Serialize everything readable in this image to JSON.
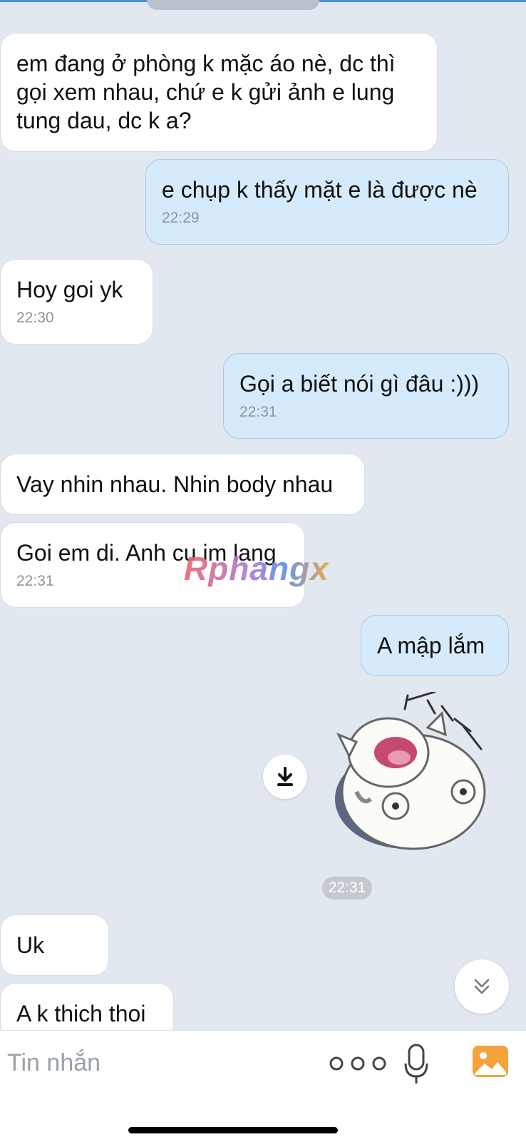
{
  "messages": [
    {
      "dir": "in",
      "text": "em đang ở phòng k mặc áo nè, dc thì\ngọi xem nhau, chứ e k gửi ảnh e lung\ntung dau, dc k a?",
      "time": ""
    },
    {
      "dir": "out",
      "text": "e chụp k thấy mặt e là được nè",
      "time": "22:29"
    },
    {
      "dir": "in",
      "text": "Hoy goi yk",
      "time": "22:30"
    },
    {
      "dir": "out",
      "text": "Gọi a biết nói gì đâu :)))",
      "time": "22:31"
    },
    {
      "dir": "in",
      "text": "Vay nhin nhau. Nhin body nhau",
      "time": ""
    },
    {
      "dir": "in",
      "text": "Goi em di. Anh cu im lang",
      "time": "22:31"
    },
    {
      "dir": "out",
      "text": "A mập lắm",
      "time": ""
    },
    {
      "dir": "in",
      "text": "Uk",
      "time": ""
    },
    {
      "dir": "in",
      "text": "A k thich thoi",
      "time": ""
    }
  ],
  "sticker": {
    "time": "22:31",
    "icon": "cat-sticker-icon"
  },
  "watermark": "Rphangx",
  "input": {
    "placeholder": "Tin nhắn"
  },
  "colors": {
    "incoming": "#ffffff",
    "outgoing": "#d5ebfb",
    "background": "#e2e8f0",
    "accent": "#f6a23a"
  }
}
